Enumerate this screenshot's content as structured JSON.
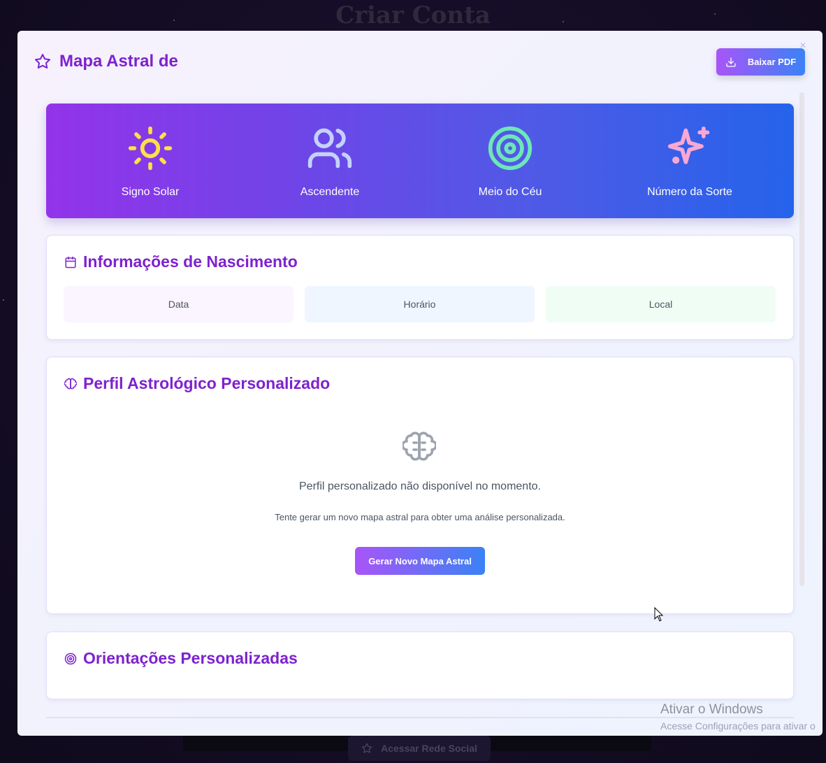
{
  "background": {
    "title": "Criar Conta",
    "bottom_button_label": "Acessar Rede Social"
  },
  "modal": {
    "title": "Mapa Astral de",
    "title_icon": "star-icon",
    "pdf_button_label": "Baixar PDF",
    "pdf_icon": "download-icon"
  },
  "hero": {
    "items": [
      {
        "label": "Signo Solar",
        "icon": "sun-icon",
        "color": "#fde047"
      },
      {
        "label": "Ascendente",
        "icon": "users-icon",
        "color": "#c4d2fb"
      },
      {
        "label": "Meio do Céu",
        "icon": "target-icon",
        "color": "#6ee7b7"
      },
      {
        "label": "Número da Sorte",
        "icon": "sparkles-icon",
        "color": "#f9a8d4"
      }
    ]
  },
  "birth_info": {
    "title": "Informações de Nascimento",
    "icon": "calendar-icon",
    "fields": [
      {
        "label": "Data",
        "bg": "#faf5ff"
      },
      {
        "label": "Horário",
        "bg": "#eff6ff"
      },
      {
        "label": "Local",
        "bg": "#f0fdf4"
      }
    ]
  },
  "profile": {
    "title": "Perfil Astrológico Personalizado",
    "icon": "brain-icon",
    "empty_message": "Perfil personalizado não disponível no momento.",
    "empty_hint": "Tente gerar um novo mapa astral para obter uma análise personalizada.",
    "generate_button_label": "Gerar Novo Mapa Astral"
  },
  "guidance": {
    "title": "Orientações Personalizadas",
    "icon": "target-icon"
  },
  "watermark": {
    "line1": "Ativar o Windows",
    "line2": "Acesse Configurações para ativar o"
  },
  "colors": {
    "accent": "#7e22ce",
    "gradient_start": "#a855f7",
    "gradient_end": "#3b82f6"
  }
}
